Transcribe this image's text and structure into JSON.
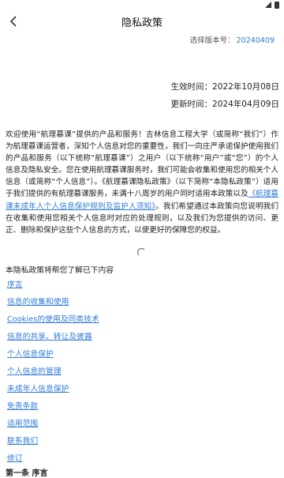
{
  "header": {
    "title": "隐私政策"
  },
  "version": {
    "label": "选择版本号：",
    "value": "20240409"
  },
  "dates": {
    "effective": "生效时间：2022年10月08日",
    "updated": "更新时间：2024年04月09日"
  },
  "intro": {
    "part1": "欢迎使用“航理慕课”提供的产品和服务！吉林信息工程大学（或简称“我们”）作为航理慕课运营者，深知个人信息对您的重要性，我们一向庄严承诺保护使用我们的产品和服务（以下统称“航理慕课”）之用户（以下统称“用户”或“您”）的个人信息及隐私安全。您在使用航理慕课服务时，我们可能会收集和使用您的相关个人信息（或简称“个人信息”）。《航理慕课隐私政策》（以下简称“本隐私政策”）适用于我们提供的有航理慕课服务，未满十八周岁的用户同时适用本政策以及",
    "link": "《航理慕课未成年人个人信息保护规则及监护人须知》",
    "part2": "。我们希望通过本政策向您说明我们在收集和使用您相关个人信息时对应的处理规则，以及我们为您提供的访问、更正、删除和保护这些个人信息的方式，以便更好的保障您的权益。"
  },
  "toc": {
    "heading": "本隐私政策将帮您了解已下内容",
    "items": [
      "序言",
      "信息的收集和使用",
      "Cookies的使用及同类技术",
      "信息的共享、转让及披露",
      "个人信息保护",
      "个人信息的管理",
      "未成年人信息保护",
      "免责条款",
      "适用范围",
      "联系我们",
      "修订"
    ]
  },
  "section": {
    "first_title": "第一条 序言"
  }
}
